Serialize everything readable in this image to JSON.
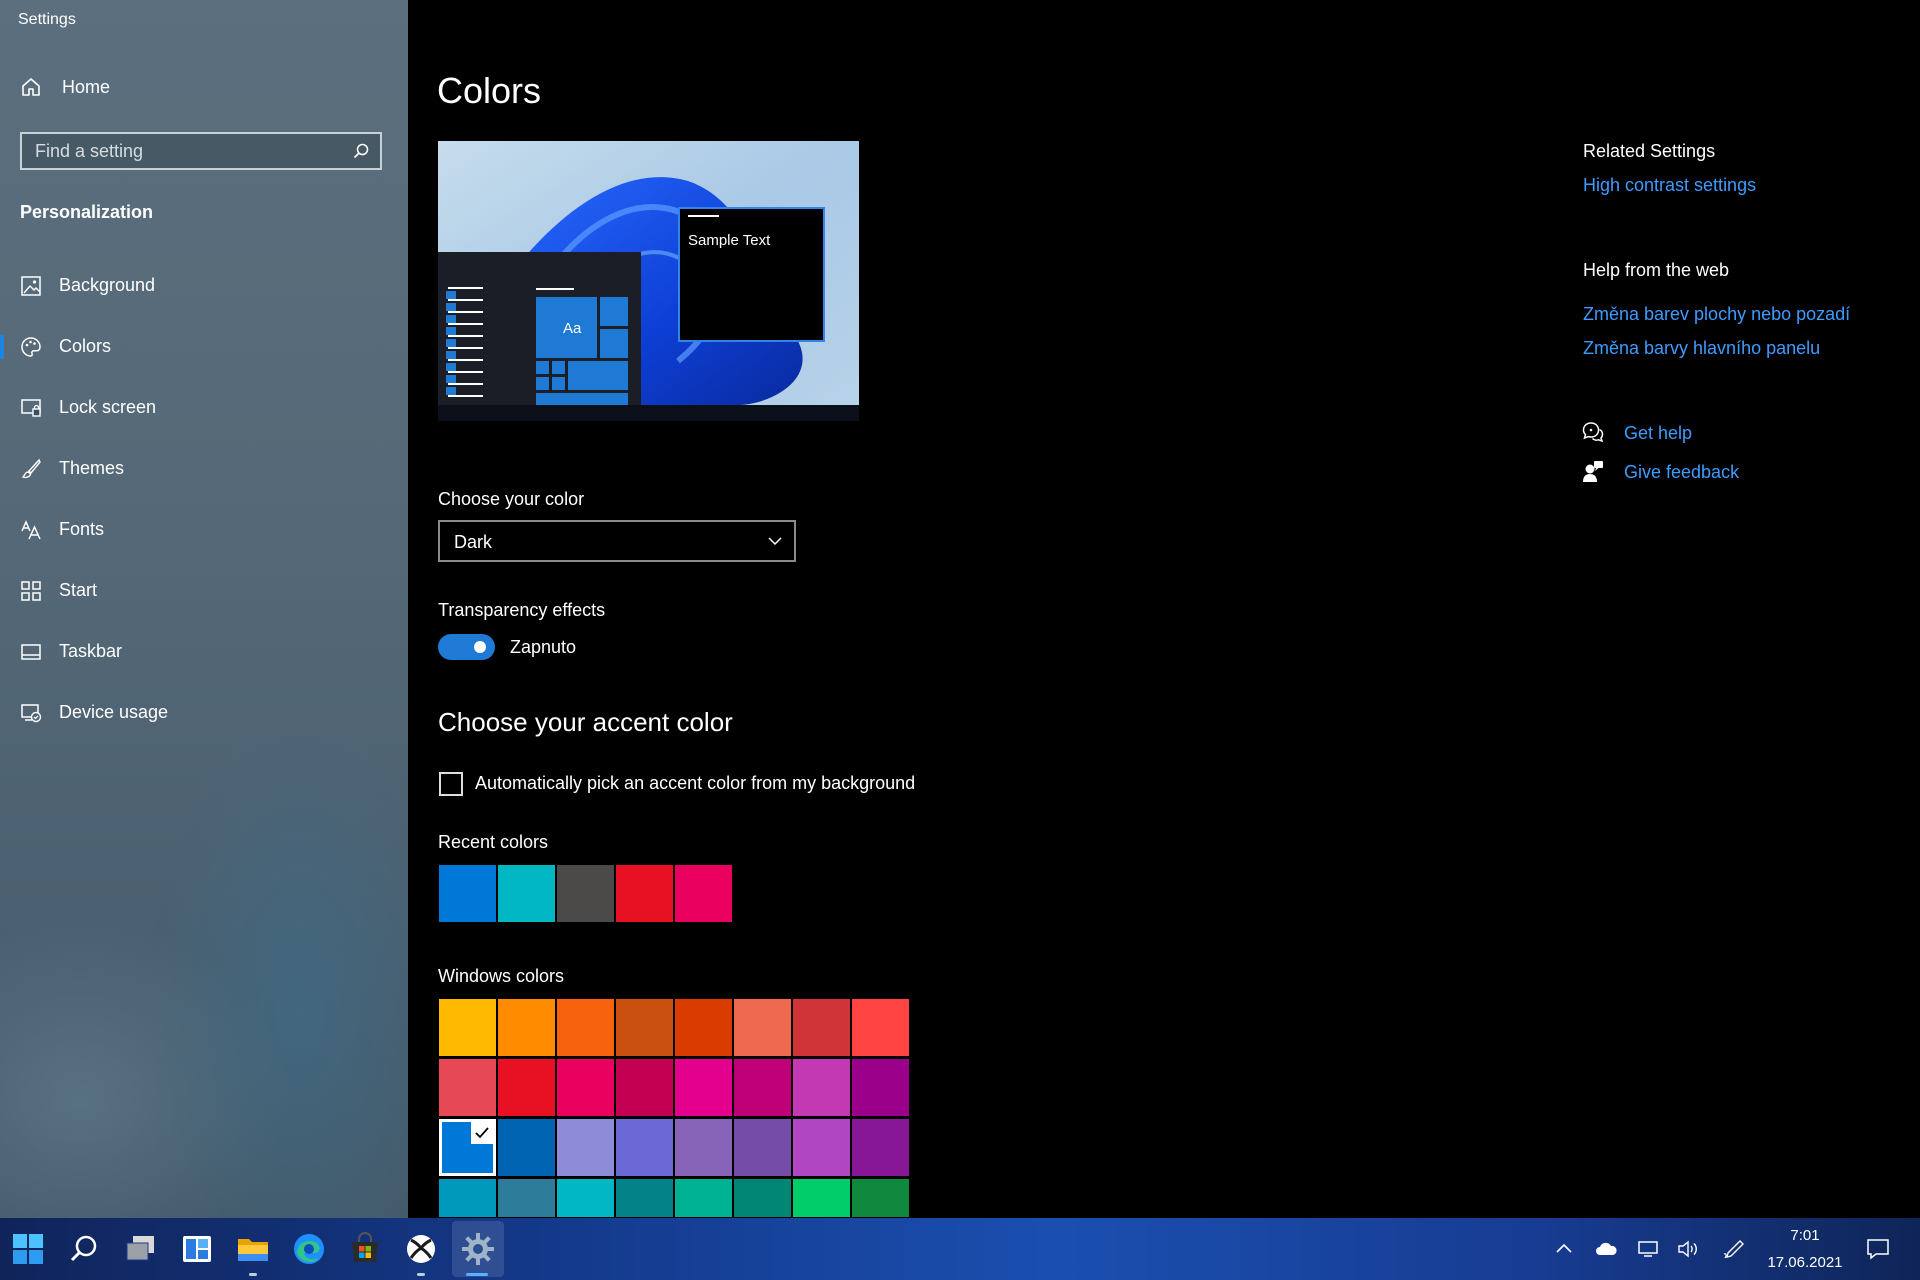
{
  "window": {
    "title": "Settings"
  },
  "sidebar": {
    "home_label": "Home",
    "search_placeholder": "Find a setting",
    "section_title": "Personalization",
    "items": [
      {
        "label": "Background",
        "icon": "image-icon"
      },
      {
        "label": "Colors",
        "icon": "palette-icon",
        "active": true
      },
      {
        "label": "Lock screen",
        "icon": "lock-screen-icon"
      },
      {
        "label": "Themes",
        "icon": "brush-icon"
      },
      {
        "label": "Fonts",
        "icon": "font-icon"
      },
      {
        "label": "Start",
        "icon": "start-grid-icon"
      },
      {
        "label": "Taskbar",
        "icon": "taskbar-icon"
      },
      {
        "label": "Device usage",
        "icon": "device-usage-icon"
      }
    ]
  },
  "main": {
    "title": "Colors",
    "preview": {
      "sample_text": "Sample Text",
      "tile_text": "Aa"
    },
    "choose_color": {
      "label": "Choose your color",
      "value": "Dark"
    },
    "transparency": {
      "label": "Transparency effects",
      "state_label": "Zapnuto",
      "on": true
    },
    "accent_heading": "Choose your accent color",
    "auto_pick": {
      "label": "Automatically pick an accent color from my background",
      "checked": false
    },
    "recent_colors": {
      "label": "Recent colors",
      "colors": [
        "#0078d7",
        "#00b7c3",
        "#4c4a48",
        "#e81123",
        "#ea005e"
      ]
    },
    "windows_colors": {
      "label": "Windows colors",
      "rows": [
        [
          "#ffb900",
          "#ff8c00",
          "#f7630c",
          "#ca5010",
          "#da3b01",
          "#ef6950",
          "#d13438",
          "#ff4343"
        ],
        [
          "#e74856",
          "#e81123",
          "#ea005e",
          "#c30052",
          "#e3008c",
          "#bf0077",
          "#c239b3",
          "#9a0089"
        ],
        [
          "#0078d7",
          "#0063b1",
          "#8e8cd8",
          "#6b69d6",
          "#8764b8",
          "#744da9",
          "#b146c2",
          "#881798"
        ],
        [
          "#0099bc",
          "#2d7d9a",
          "#00b7c3",
          "#038387",
          "#00b294",
          "#018574",
          "#00cc6a",
          "#10893e"
        ]
      ],
      "selected": [
        2,
        0
      ]
    }
  },
  "related": {
    "related_title": "Related Settings",
    "high_contrast": "High contrast settings",
    "help_title": "Help from the web",
    "web_links": [
      "Změna barev plochy nebo pozadí",
      "Změna barvy hlavního panelu"
    ],
    "get_help": "Get help",
    "give_feedback": "Give feedback"
  },
  "taskbar": {
    "time": "7:01",
    "date": "17.06.2021",
    "apps": [
      "windows-start-icon",
      "search-icon",
      "task-view-icon",
      "widgets-icon",
      "file-explorer-icon",
      "edge-icon",
      "store-icon",
      "xbox-icon",
      "settings-gear-icon"
    ],
    "tray": [
      "chevron-up-icon",
      "onedrive-cloud-icon",
      "network-icon",
      "volume-icon",
      "pen-icon",
      "notification-icon"
    ]
  }
}
